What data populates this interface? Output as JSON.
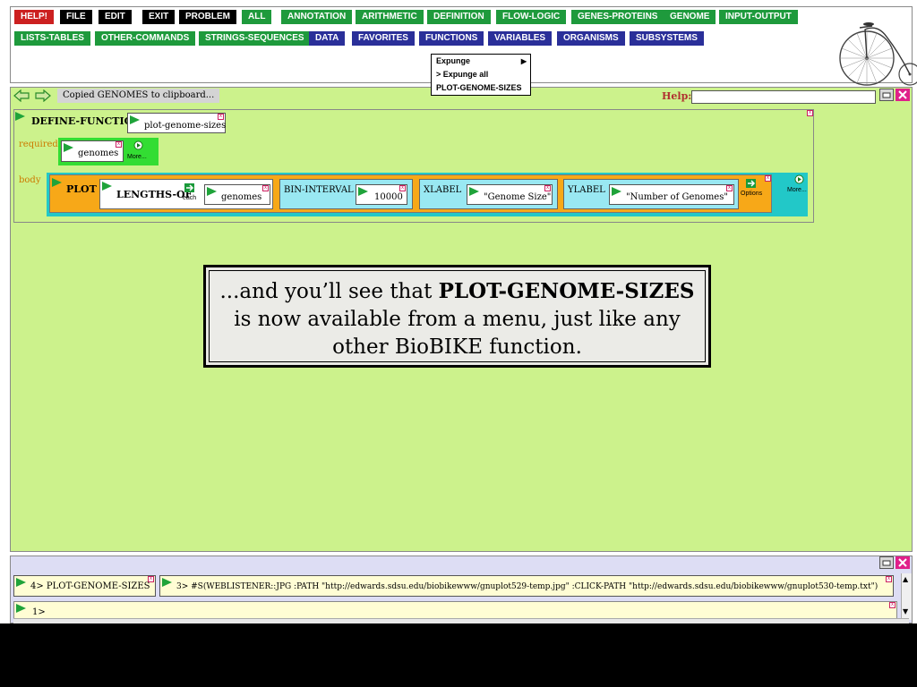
{
  "menu": {
    "row1": [
      {
        "label": "HELP!",
        "color": "red"
      },
      {
        "label": "FILE",
        "color": "black"
      },
      {
        "label": "EDIT",
        "color": "black"
      },
      {
        "label": "EXIT",
        "color": "black"
      },
      {
        "label": "PROBLEM",
        "color": "black"
      },
      {
        "label": "ALL",
        "color": "green"
      },
      {
        "label": "ANNOTATION",
        "color": "green"
      },
      {
        "label": "ARITHMETIC",
        "color": "green"
      },
      {
        "label": "DEFINITION",
        "color": "green"
      },
      {
        "label": "FLOW-LOGIC",
        "color": "green"
      },
      {
        "label": "GENES-PROTEINS",
        "color": "green"
      },
      {
        "label": "GENOME",
        "color": "green"
      },
      {
        "label": "INPUT-OUTPUT",
        "color": "green"
      }
    ],
    "row2": [
      {
        "label": "LISTS-TABLES",
        "color": "green"
      },
      {
        "label": "OTHER-COMMANDS",
        "color": "green"
      },
      {
        "label": "STRINGS-SEQUENCES",
        "color": "green"
      },
      {
        "label": "DATA",
        "color": "blue"
      },
      {
        "label": "FAVORITES",
        "color": "blue"
      },
      {
        "label": "FUNCTIONS",
        "color": "blue"
      },
      {
        "label": "VARIABLES",
        "color": "blue"
      },
      {
        "label": "ORGANISMS",
        "color": "blue"
      },
      {
        "label": "SUBSYSTEMS",
        "color": "blue"
      }
    ],
    "colors": {
      "red": "#cc2020",
      "black": "#000000",
      "green": "#1e9a3c",
      "blue": "#2a2f99"
    }
  },
  "dropdown": {
    "items": [
      "Expunge",
      "> Expunge all",
      "PLOT-GENOME-SIZES"
    ]
  },
  "toolbar": {
    "status": "Copied GENOMES to clipboard...",
    "help_label": "Help:",
    "help_value": ""
  },
  "define": {
    "keyword": "DEFINE-FUNCTION",
    "name": "plot-genome-sizes",
    "required_label": "required",
    "param": "genomes",
    "param_more": "More...",
    "body_label": "body",
    "plot_kw": "PLOT",
    "lengths_kw": "LENGTHS-OF",
    "each_label": "each",
    "lengths_arg": "genomes",
    "bin_kw": "BIN-INTERVAL",
    "bin_value": "10000",
    "xlabel_kw": "XLABEL",
    "xlabel_value": "\"Genome Size\"",
    "ylabel_kw": "YLABEL",
    "ylabel_value": "\"Number of Genomes\"",
    "options_label": "Options",
    "more_label": "More..."
  },
  "note": {
    "pre": "...and you’ll see that ",
    "bold": "PLOT-GENOME-SIZES",
    "post": " is now available from a menu, just like any other BioBIKE function."
  },
  "console": {
    "hist1": "4>  PLOT-GENOME-SIZES",
    "hist2": "3>  #S(WEBLISTENER::JPG :PATH \"http://edwards.sdsu.edu/biobikewww/gnuplot529-temp.jpg\" :CLICK-PATH \"http://edwards.sdsu.edu/biobikewww/gnuplot530-temp.txt\")",
    "prompt": "1>"
  },
  "icons": {
    "back": "back-arrow-icon",
    "forward": "forward-arrow-icon",
    "minimize": "minimize-icon",
    "close": "close-icon",
    "logo": "penny-farthing-bicycle-logo"
  }
}
